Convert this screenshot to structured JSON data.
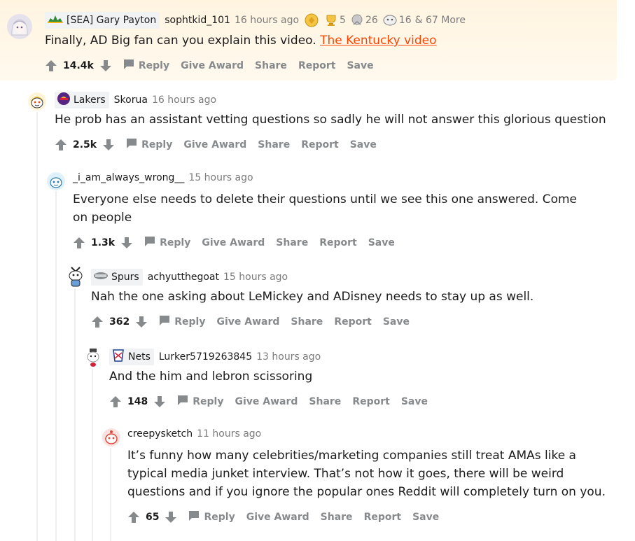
{
  "comments": [
    {
      "flair": "[SEA] Gary Payton",
      "author": "sophtkid_101",
      "time": "16 hours ago",
      "award_counts": [
        "5",
        "26",
        "16"
      ],
      "award_more": "& 67 More",
      "body_prefix": "Finally, AD Big fan can you explain this video. ",
      "link": "The Kentucky video",
      "score": "14.4k",
      "avatar_icon": "anime-girl-avatar-icon"
    },
    {
      "flair": "Lakers",
      "author": "Skorua",
      "time": "16 hours ago",
      "body": "He prob has an assistant vetting questions so sadly he will not answer this glorious question",
      "score": "2.5k",
      "avatar_icon": "snoo-avatar-icon"
    },
    {
      "author": "_i_am_always_wrong__",
      "time": "15 hours ago",
      "body": "Everyone else needs to delete their questions until we see this one answered. Come on people",
      "score": "1.3k",
      "avatar_icon": "snoo-avatar-icon"
    },
    {
      "flair": "Spurs",
      "author": "achyutthegoat",
      "time": "15 hours ago",
      "body": "Nah the one asking about LeMickey and ADisney needs to stay up as well.",
      "score": "362",
      "avatar_icon": "snoo-avatar-icon"
    },
    {
      "flair": "Nets",
      "author": "Lurker5719263845",
      "time": "13 hours ago",
      "body": "And the him and lebron scissoring",
      "score": "148",
      "avatar_icon": "snoo-avatar-icon"
    },
    {
      "author": "creepysketch",
      "time": "11 hours ago",
      "body": "It’s funny how many celebrities/marketing companies still treat AMAs like a typical media junket interview. That’s not how it goes, there will be weird questions and if you ignore the popular ones Reddit will completely turn on you.",
      "score": "65",
      "avatar_icon": "snoo-avatar-icon"
    }
  ],
  "actions": {
    "reply": "Reply",
    "give_award": "Give Award",
    "share": "Share",
    "report": "Report",
    "save": "Save"
  },
  "colors": {
    "highlight_bg": "#fff4e0",
    "link": "#ff4500",
    "meta_gray": "#7c7c7c",
    "action_gray": "#878a8c"
  }
}
